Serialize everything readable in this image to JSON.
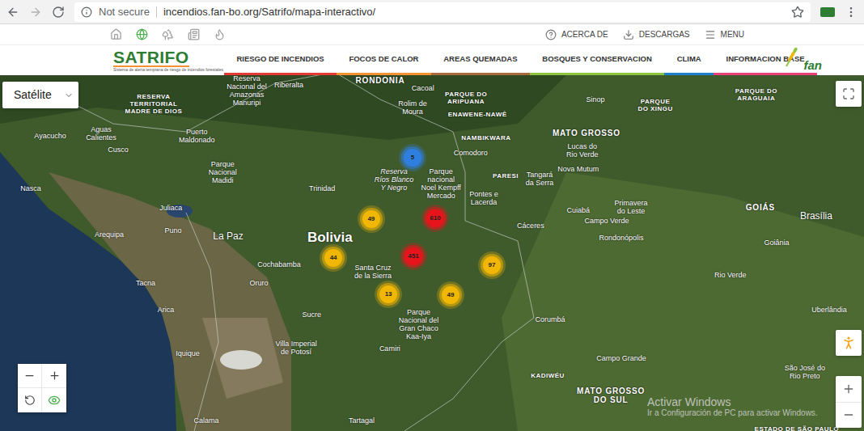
{
  "browser": {
    "security": "Not secure",
    "address": "incendios.fan-bo.org/Satrifo/mapa-interactivo/"
  },
  "topbar": {
    "links": [
      {
        "label": "ACERCA DE"
      },
      {
        "label": "DESCARGAS"
      },
      {
        "label": "MENU"
      }
    ]
  },
  "header": {
    "logo": {
      "title": "SATRIFO",
      "tagline": "Sistema de alerta temprana de riesgo de incendios forestales"
    },
    "partner": "fan",
    "nav": [
      {
        "label": "RIESGO DE INCENDIOS",
        "color": "#e53935"
      },
      {
        "label": "FOCOS DE CALOR",
        "color": "#f29233"
      },
      {
        "label": "AREAS QUEMADAS",
        "color": "#a86a3d"
      },
      {
        "label": "BOSQUES Y CONSERVACION",
        "color": "#8cc63f"
      },
      {
        "label": "CLIMA",
        "color": "#1e7fd0"
      },
      {
        "label": "INFORMACION BASE",
        "color": "#e9407a"
      }
    ]
  },
  "map": {
    "layer_select": {
      "label": "Satélite"
    },
    "labels": [
      {
        "text": "RESERVA\nTERRITORIAL\nMADRE DE DIOS",
        "kind": "region",
        "lon": -70.71,
        "lat": -12.24
      },
      {
        "text": "Reserva\nNacional del\nAmazonas\nManuripi",
        "kind": "city",
        "lon": -67.51,
        "lat": -11.82
      },
      {
        "text": "RONDONIA",
        "kind": "state",
        "lon": -62.92,
        "lat": -11.49
      },
      {
        "text": "PARQUE DO\nARIPUANA",
        "kind": "region",
        "lon": -59.97,
        "lat": -12.06
      },
      {
        "text": "ENAWENE-NAWÊ",
        "kind": "region",
        "lon": -59.58,
        "lat": -12.58
      },
      {
        "text": "PARQUE\nDO XINGU",
        "kind": "region",
        "lon": -53.46,
        "lat": -12.29
      },
      {
        "text": "PARQUE DO\nARAGUAIA",
        "kind": "region",
        "lon": -49.99,
        "lat": -11.95
      },
      {
        "text": "NAMBIKWARA",
        "kind": "region",
        "lon": -59.28,
        "lat": -13.33
      },
      {
        "text": "MATO GROSSO",
        "kind": "state",
        "lon": -55.83,
        "lat": -13.18
      },
      {
        "text": "PARESI",
        "kind": "region",
        "lon": -58.61,
        "lat": -14.55
      },
      {
        "text": "Bolivia",
        "kind": "country",
        "lon": -64.65,
        "lat": -16.55
      },
      {
        "text": "GOIÁS",
        "kind": "state",
        "lon": -49.85,
        "lat": -15.56
      },
      {
        "text": "MATO GROSSO\nDO SUL",
        "kind": "state",
        "lon": -54.99,
        "lat": -21.62
      },
      {
        "text": "KADIWÉU",
        "kind": "region",
        "lon": -57.16,
        "lat": -20.97
      },
      {
        "text": "ESTADO DE SÃO PAULO",
        "kind": "region",
        "lon": -48.6,
        "lat": -22.67
      },
      {
        "text": "Riberalta",
        "kind": "city",
        "lon": -66.06,
        "lat": -11.64
      },
      {
        "text": "Cacoal",
        "kind": "city",
        "lon": -61.45,
        "lat": -11.75
      },
      {
        "text": "Rolim de\nMoura",
        "kind": "city",
        "lon": -61.81,
        "lat": -12.37
      },
      {
        "text": "Sinop",
        "kind": "city",
        "lon": -55.52,
        "lat": -12.11
      },
      {
        "text": "Ayacucho",
        "kind": "city",
        "lon": -74.27,
        "lat": -13.28
      },
      {
        "text": "Aguas\nCalientes",
        "kind": "city",
        "lon": -72.52,
        "lat": -13.2
      },
      {
        "text": "Cusco",
        "kind": "city",
        "lon": -71.93,
        "lat": -13.72
      },
      {
        "text": "Puerto\nMaldonado",
        "kind": "city",
        "lon": -69.23,
        "lat": -13.28
      },
      {
        "text": "Parque\nNacional\nMadidi",
        "kind": "city",
        "lon": -68.34,
        "lat": -14.45
      },
      {
        "text": "Trinidad",
        "kind": "city",
        "lon": -64.92,
        "lat": -14.97
      },
      {
        "text": "Reserva\nRíos Blanco\nY Negro",
        "kind": "italic",
        "lon": -62.45,
        "lat": -14.68
      },
      {
        "text": "Parque\nnacional\nNoel Kempff\nMercado",
        "kind": "city",
        "lon": -60.83,
        "lat": -14.8
      },
      {
        "text": "Comodoro",
        "kind": "city",
        "lon": -59.81,
        "lat": -13.82
      },
      {
        "text": "Lucas do\nRio Verde",
        "kind": "city",
        "lon": -55.97,
        "lat": -13.75
      },
      {
        "text": "Nova Mutum",
        "kind": "city",
        "lon": -56.11,
        "lat": -14.34
      },
      {
        "text": "Tangará\nda Serra",
        "kind": "city",
        "lon": -57.44,
        "lat": -14.66
      },
      {
        "text": "Pontes e\nLacerda",
        "kind": "city",
        "lon": -59.36,
        "lat": -15.28
      },
      {
        "text": "Primavera\ndo Leste",
        "kind": "city",
        "lon": -54.3,
        "lat": -15.56
      },
      {
        "text": "Cuiabá",
        "kind": "city",
        "lon": -56.11,
        "lat": -15.67
      },
      {
        "text": "Campo Verde",
        "kind": "city",
        "lon": -55.13,
        "lat": -16.01
      },
      {
        "text": "Cáceres",
        "kind": "city",
        "lon": -57.75,
        "lat": -16.16
      },
      {
        "text": "Rondonópolis",
        "kind": "city",
        "lon": -54.63,
        "lat": -16.55
      },
      {
        "text": "Juliaca",
        "kind": "city",
        "lon": -70.12,
        "lat": -15.59
      },
      {
        "text": "Puno",
        "kind": "city",
        "lon": -70.04,
        "lat": -16.32
      },
      {
        "text": "Arequipa",
        "kind": "city",
        "lon": -72.24,
        "lat": -16.45
      },
      {
        "text": "La Paz",
        "kind": "capital",
        "lon": -68.15,
        "lat": -16.5
      },
      {
        "text": "Nasca",
        "kind": "city",
        "lon": -74.94,
        "lat": -14.97
      },
      {
        "text": "Cochabamba",
        "kind": "city",
        "lon": -66.4,
        "lat": -17.41
      },
      {
        "text": "Santa Cruz\nde la Sierra",
        "kind": "city",
        "lon": -63.17,
        "lat": -17.64
      },
      {
        "text": "Oruro",
        "kind": "city",
        "lon": -67.09,
        "lat": -18.01
      },
      {
        "text": "Tacna",
        "kind": "city",
        "lon": -70.99,
        "lat": -18.01
      },
      {
        "text": "Arica",
        "kind": "city",
        "lon": -70.29,
        "lat": -18.86
      },
      {
        "text": "Sucre",
        "kind": "city",
        "lon": -65.28,
        "lat": -19.02
      },
      {
        "text": "Villa Imperial\nde Potosí",
        "kind": "city",
        "lon": -65.81,
        "lat": -20.08
      },
      {
        "text": "Iquique",
        "kind": "city",
        "lon": -69.54,
        "lat": -20.27
      },
      {
        "text": "Parque\nNacional del\nGran Chaco\nKaa-Iya",
        "kind": "city",
        "lon": -61.6,
        "lat": -19.32
      },
      {
        "text": "Camiri",
        "kind": "city",
        "lon": -62.59,
        "lat": -20.12
      },
      {
        "text": "Corumbá",
        "kind": "city",
        "lon": -57.08,
        "lat": -19.18
      },
      {
        "text": "Campo Grande",
        "kind": "city",
        "lon": -54.63,
        "lat": -20.42
      },
      {
        "text": "Brasília",
        "kind": "capital",
        "lon": -47.93,
        "lat": -15.85
      },
      {
        "text": "Goiânia",
        "kind": "city",
        "lon": -49.29,
        "lat": -16.71
      },
      {
        "text": "Rio Verde",
        "kind": "city",
        "lon": -50.88,
        "lat": -17.75
      },
      {
        "text": "Uberlândia",
        "kind": "city",
        "lon": -47.48,
        "lat": -18.86
      },
      {
        "text": "São José do\nRio Preto",
        "kind": "city",
        "lon": -48.32,
        "lat": -20.86
      },
      {
        "text": "Calama",
        "kind": "city",
        "lon": -68.9,
        "lat": -22.42
      },
      {
        "text": "Tartagal",
        "kind": "city",
        "lon": -63.56,
        "lat": -22.42
      }
    ],
    "clusters": [
      {
        "count": "5",
        "color": "#2f7fe0",
        "lon": -61.81,
        "lat": -13.98
      },
      {
        "count": "610",
        "color": "#e8141b",
        "lon": -61.03,
        "lat": -15.93
      },
      {
        "count": "49",
        "color": "#f2b705",
        "lon": -63.23,
        "lat": -15.95
      },
      {
        "count": "44",
        "color": "#f2b705",
        "lon": -64.53,
        "lat": -17.2
      },
      {
        "count": "451",
        "color": "#e8141b",
        "lon": -61.78,
        "lat": -17.15
      },
      {
        "count": "97",
        "color": "#f2b705",
        "lon": -59.08,
        "lat": -17.44
      },
      {
        "count": "13",
        "color": "#f2b705",
        "lon": -62.64,
        "lat": -18.37
      },
      {
        "count": "49",
        "color": "#f2b705",
        "lon": -60.5,
        "lat": -18.4
      }
    ],
    "watermark": {
      "title": "Activar Windows",
      "subtitle": "Ir a Configuración de PC para activar Windows."
    }
  }
}
